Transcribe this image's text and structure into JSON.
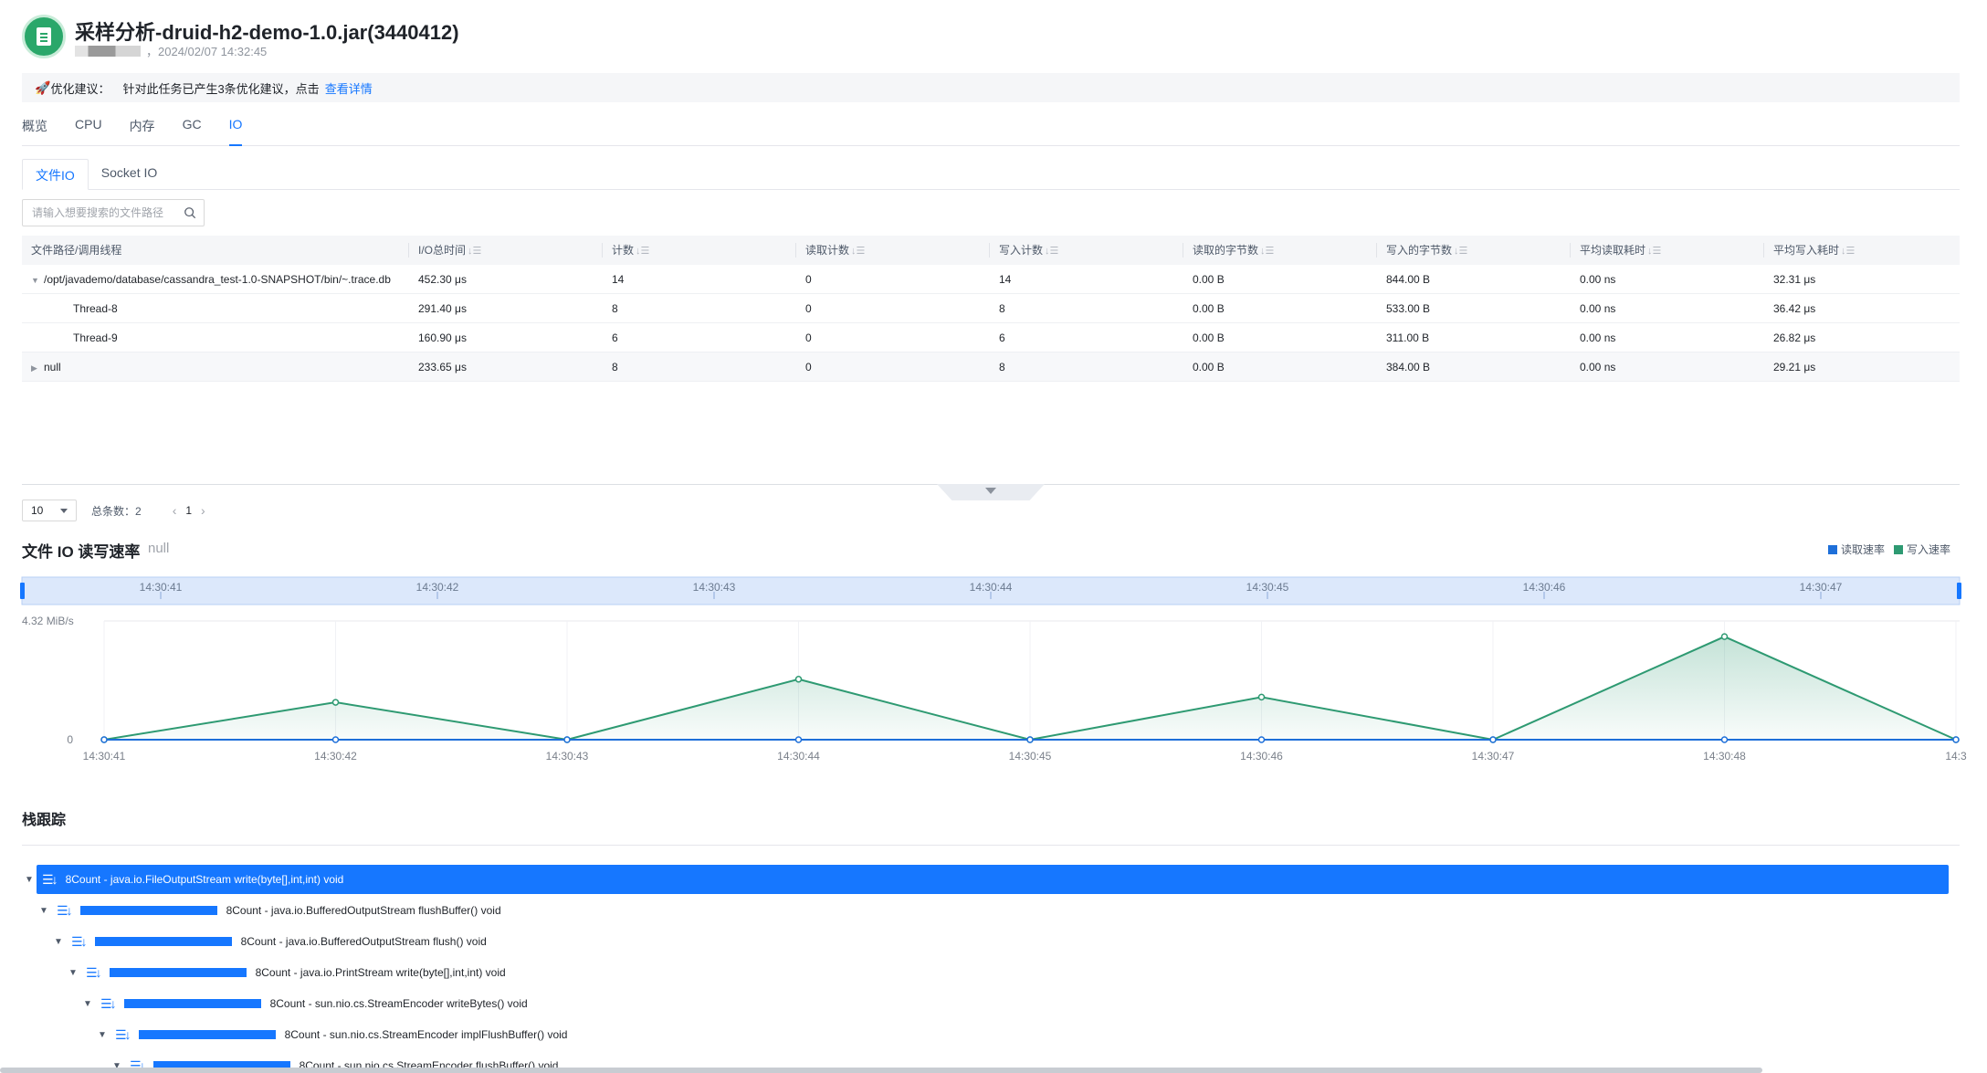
{
  "header": {
    "title": "采样分析-druid-h2-demo-1.0.jar(3440412)",
    "meta_suffix": "，2024/02/07 14:32:45"
  },
  "advice": {
    "icon": "rocket-icon",
    "label": "优化建议：",
    "text": "针对此任务已产生3条优化建议，点击",
    "link": "查看详情"
  },
  "tabs": [
    "概览",
    "CPU",
    "内存",
    "GC",
    "IO"
  ],
  "active_tab": "IO",
  "subtabs": [
    "文件IO",
    "Socket IO"
  ],
  "search": {
    "placeholder": "请输入想要搜索的文件路径"
  },
  "table": {
    "columns": [
      "文件路径/调用线程",
      "I/O总时间",
      "计数",
      "读取计数",
      "写入计数",
      "读取的字节数",
      "写入的字节数",
      "平均读取耗时",
      "平均写入耗时"
    ],
    "rows": [
      [
        "/opt/javademo/database/cassandra_test-1.0-SNAPSHOT/bin/~.trace.db",
        "452.30 μs",
        "14",
        "0",
        "14",
        "0.00 B",
        "844.00 B",
        "0.00 ns",
        "32.31 μs"
      ],
      [
        "Thread-8",
        "291.40 μs",
        "8",
        "0",
        "8",
        "0.00 B",
        "533.00 B",
        "0.00 ns",
        "36.42 μs"
      ],
      [
        "Thread-9",
        "160.90 μs",
        "6",
        "0",
        "6",
        "0.00 B",
        "311.00 B",
        "0.00 ns",
        "26.82 μs"
      ],
      [
        "null",
        "233.65 μs",
        "8",
        "0",
        "8",
        "0.00 B",
        "384.00 B",
        "0.00 ns",
        "29.21 μs"
      ]
    ]
  },
  "pager": {
    "page_size": "10",
    "total_label": "总条数：2",
    "page": "1"
  },
  "chart": {
    "title": "文件 IO 读写速率",
    "subtitle": "null",
    "legend": [
      {
        "name": "读取速率",
        "color": "#1e6fd9"
      },
      {
        "name": "写入速率",
        "color": "#2e9a72"
      }
    ]
  },
  "chart_data": {
    "type": "area",
    "x": [
      "14:30:41",
      "14:30:42",
      "14:30:43",
      "14:30:44",
      "14:30:45",
      "14:30:46",
      "14:30:47",
      "14:30:48",
      "14:3"
    ],
    "series": [
      {
        "name": "读取速率",
        "values": [
          0,
          0,
          0,
          0,
          0,
          0,
          0,
          0,
          0
        ]
      },
      {
        "name": "写入速率",
        "values": [
          0,
          1.36,
          0,
          2.2,
          0,
          1.55,
          0,
          3.75,
          0
        ]
      }
    ],
    "y_tick_labels": [
      "0",
      "4.32 MiB/s"
    ],
    "ylim": [
      0,
      4.32
    ],
    "ylabel": "",
    "xlabel": "",
    "brush_ticks": [
      "14:30:41",
      "14:30:42",
      "14:30:43",
      "14:30:44",
      "14:30:45",
      "14:30:46",
      "14:30:47"
    ],
    "legend_position": "top-right",
    "grid": true
  },
  "stack": {
    "title": "栈跟踪",
    "rows": [
      "8Count - java.io.FileOutputStream write(byte[],int,int) void",
      "8Count - java.io.BufferedOutputStream flushBuffer() void",
      "8Count - java.io.BufferedOutputStream flush() void",
      "8Count - java.io.PrintStream write(byte[],int,int) void",
      "8Count - sun.nio.cs.StreamEncoder writeBytes() void",
      "8Count - sun.nio.cs.StreamEncoder implFlushBuffer() void",
      "8Count - sun.nio.cs.StreamEncoder flushBuffer() void"
    ]
  }
}
